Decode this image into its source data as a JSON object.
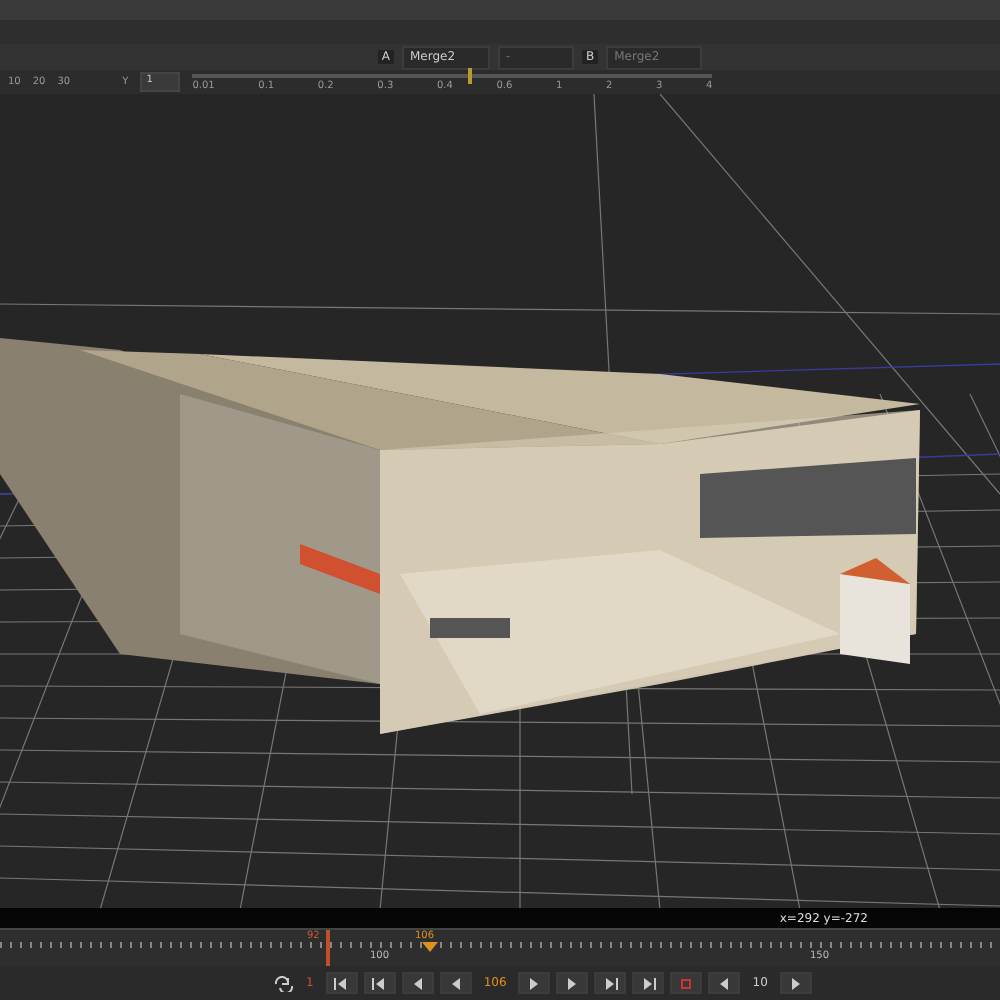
{
  "input_bar": {
    "input_a": {
      "letter": "A",
      "node": "Merge2"
    },
    "operation": "-",
    "input_b": {
      "letter": "B",
      "node": "Merge2"
    }
  },
  "gain_ruler": {
    "channel_label": "Y",
    "value": "1",
    "scale_labels": [
      "10",
      "20",
      "30",
      "0.01",
      "0.1",
      "0.2",
      "0.3",
      "0.4",
      "0.6",
      "1",
      "2",
      "3",
      "4"
    ],
    "level": 0.53
  },
  "viewer": {
    "coordinates": "x=292 y=-272"
  },
  "timeline": {
    "playhead": {
      "label": "92",
      "level": 0.325
    },
    "out_marker": {
      "label": "106",
      "level": 0.43
    },
    "tick_labels": [
      "100",
      "150"
    ]
  },
  "transport": {
    "in_frame": "1",
    "current_frame": "106",
    "step": "10"
  }
}
